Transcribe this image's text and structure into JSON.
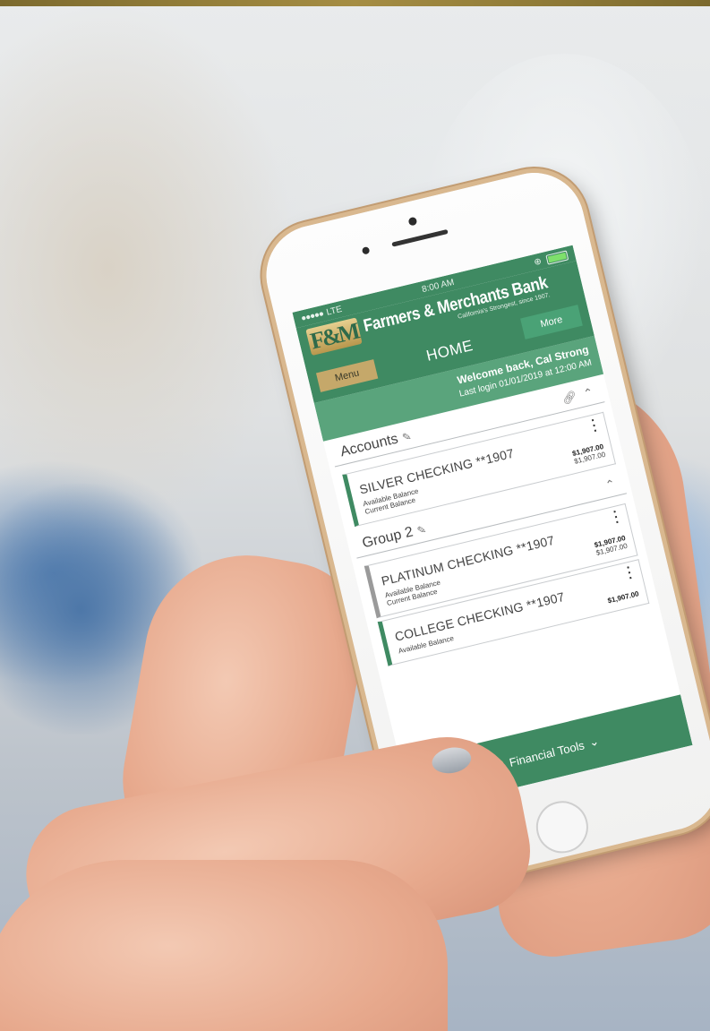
{
  "status_bar": {
    "carrier": "LTE",
    "time": "8:00 AM"
  },
  "header": {
    "logo_mark": "F&M",
    "bank_name": "Farmers & Merchants Bank",
    "tagline": "California's Strongest, since 1907.",
    "menu_label": "Menu",
    "page_title": "HOME",
    "more_label": "More"
  },
  "welcome": {
    "greeting": "Welcome back, Cal Strong",
    "last_login": "Last login 01/01/2019 at 12:00 AM"
  },
  "sections": [
    {
      "title": "Accounts",
      "accounts": [
        {
          "name": "SILVER CHECKING **1907",
          "available_label": "Available Balance",
          "current_label": "Current Balance",
          "available_value": "$1,907.00",
          "current_value": "$1,907.00"
        }
      ]
    },
    {
      "title": "Group 2",
      "accounts": [
        {
          "name": "PLATINUM CHECKING **1907",
          "available_label": "Available Balance",
          "current_label": "Current Balance",
          "available_value": "$1,907.00",
          "current_value": "$1,907.00"
        },
        {
          "name": "COLLEGE CHECKING **1907",
          "available_label": "Available Balance",
          "available_value": "$1,907.00"
        }
      ]
    }
  ],
  "footer": {
    "tools_label": "Financial Tools"
  },
  "colors": {
    "brand_green": "#3f8a62",
    "welcome_green": "#5aa47c",
    "gold": "#c5a86a"
  },
  "icons": [
    "pencil-icon",
    "link-icon",
    "chevron-up-icon",
    "kebab-menu-icon",
    "chevron-down-icon",
    "financial-tools-icon"
  ]
}
